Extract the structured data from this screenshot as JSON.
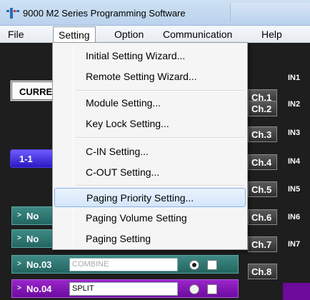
{
  "window": {
    "title": "9000 M2 Series Programming Software"
  },
  "menubar": {
    "items": [
      {
        "label": "File"
      },
      {
        "label": "Setting"
      },
      {
        "label": "Option"
      },
      {
        "label": "Communication"
      },
      {
        "label": "Help"
      }
    ],
    "open_menu": "Setting"
  },
  "setting_menu": {
    "items": [
      {
        "label": "Initial Setting Wizard..."
      },
      {
        "label": "Remote Setting Wizard..."
      },
      {
        "label": "Module Setting..."
      },
      {
        "label": "Key Lock Setting..."
      },
      {
        "label": "C-IN Setting..."
      },
      {
        "label": "C-OUT Setting..."
      },
      {
        "label": "Paging Priority Setting...",
        "highlighted": true
      },
      {
        "label": "Paging Volume Setting"
      },
      {
        "label": "Paging Setting"
      }
    ]
  },
  "main": {
    "current_label": "CURRE",
    "mode_button": "1-1",
    "zones": [
      {
        "label": "No",
        "arrow": ">"
      },
      {
        "label": "No",
        "arrow": ">"
      },
      {
        "label": "No.03",
        "arrow": ">",
        "value": "COMBINE",
        "radio_selected": true,
        "checked": false
      },
      {
        "label": "No.04",
        "arrow": ">",
        "value": "SPLIT",
        "radio_selected": false,
        "checked": false
      }
    ],
    "channels": [
      "Ch.1",
      "Ch.2",
      "Ch.3",
      "Ch.4",
      "Ch.5",
      "Ch.6",
      "Ch.7",
      "Ch.8"
    ],
    "inputs": [
      "IN1",
      "IN2",
      "IN3",
      "IN4",
      "IN5",
      "IN6",
      "IN7"
    ]
  },
  "colors": {
    "background": "#1e1e1e",
    "zone_teal": "#2f7470",
    "zone_purple": "#7f10b0",
    "mode_button": "#3b2be0",
    "menu_highlight": "#dbe9fb"
  }
}
